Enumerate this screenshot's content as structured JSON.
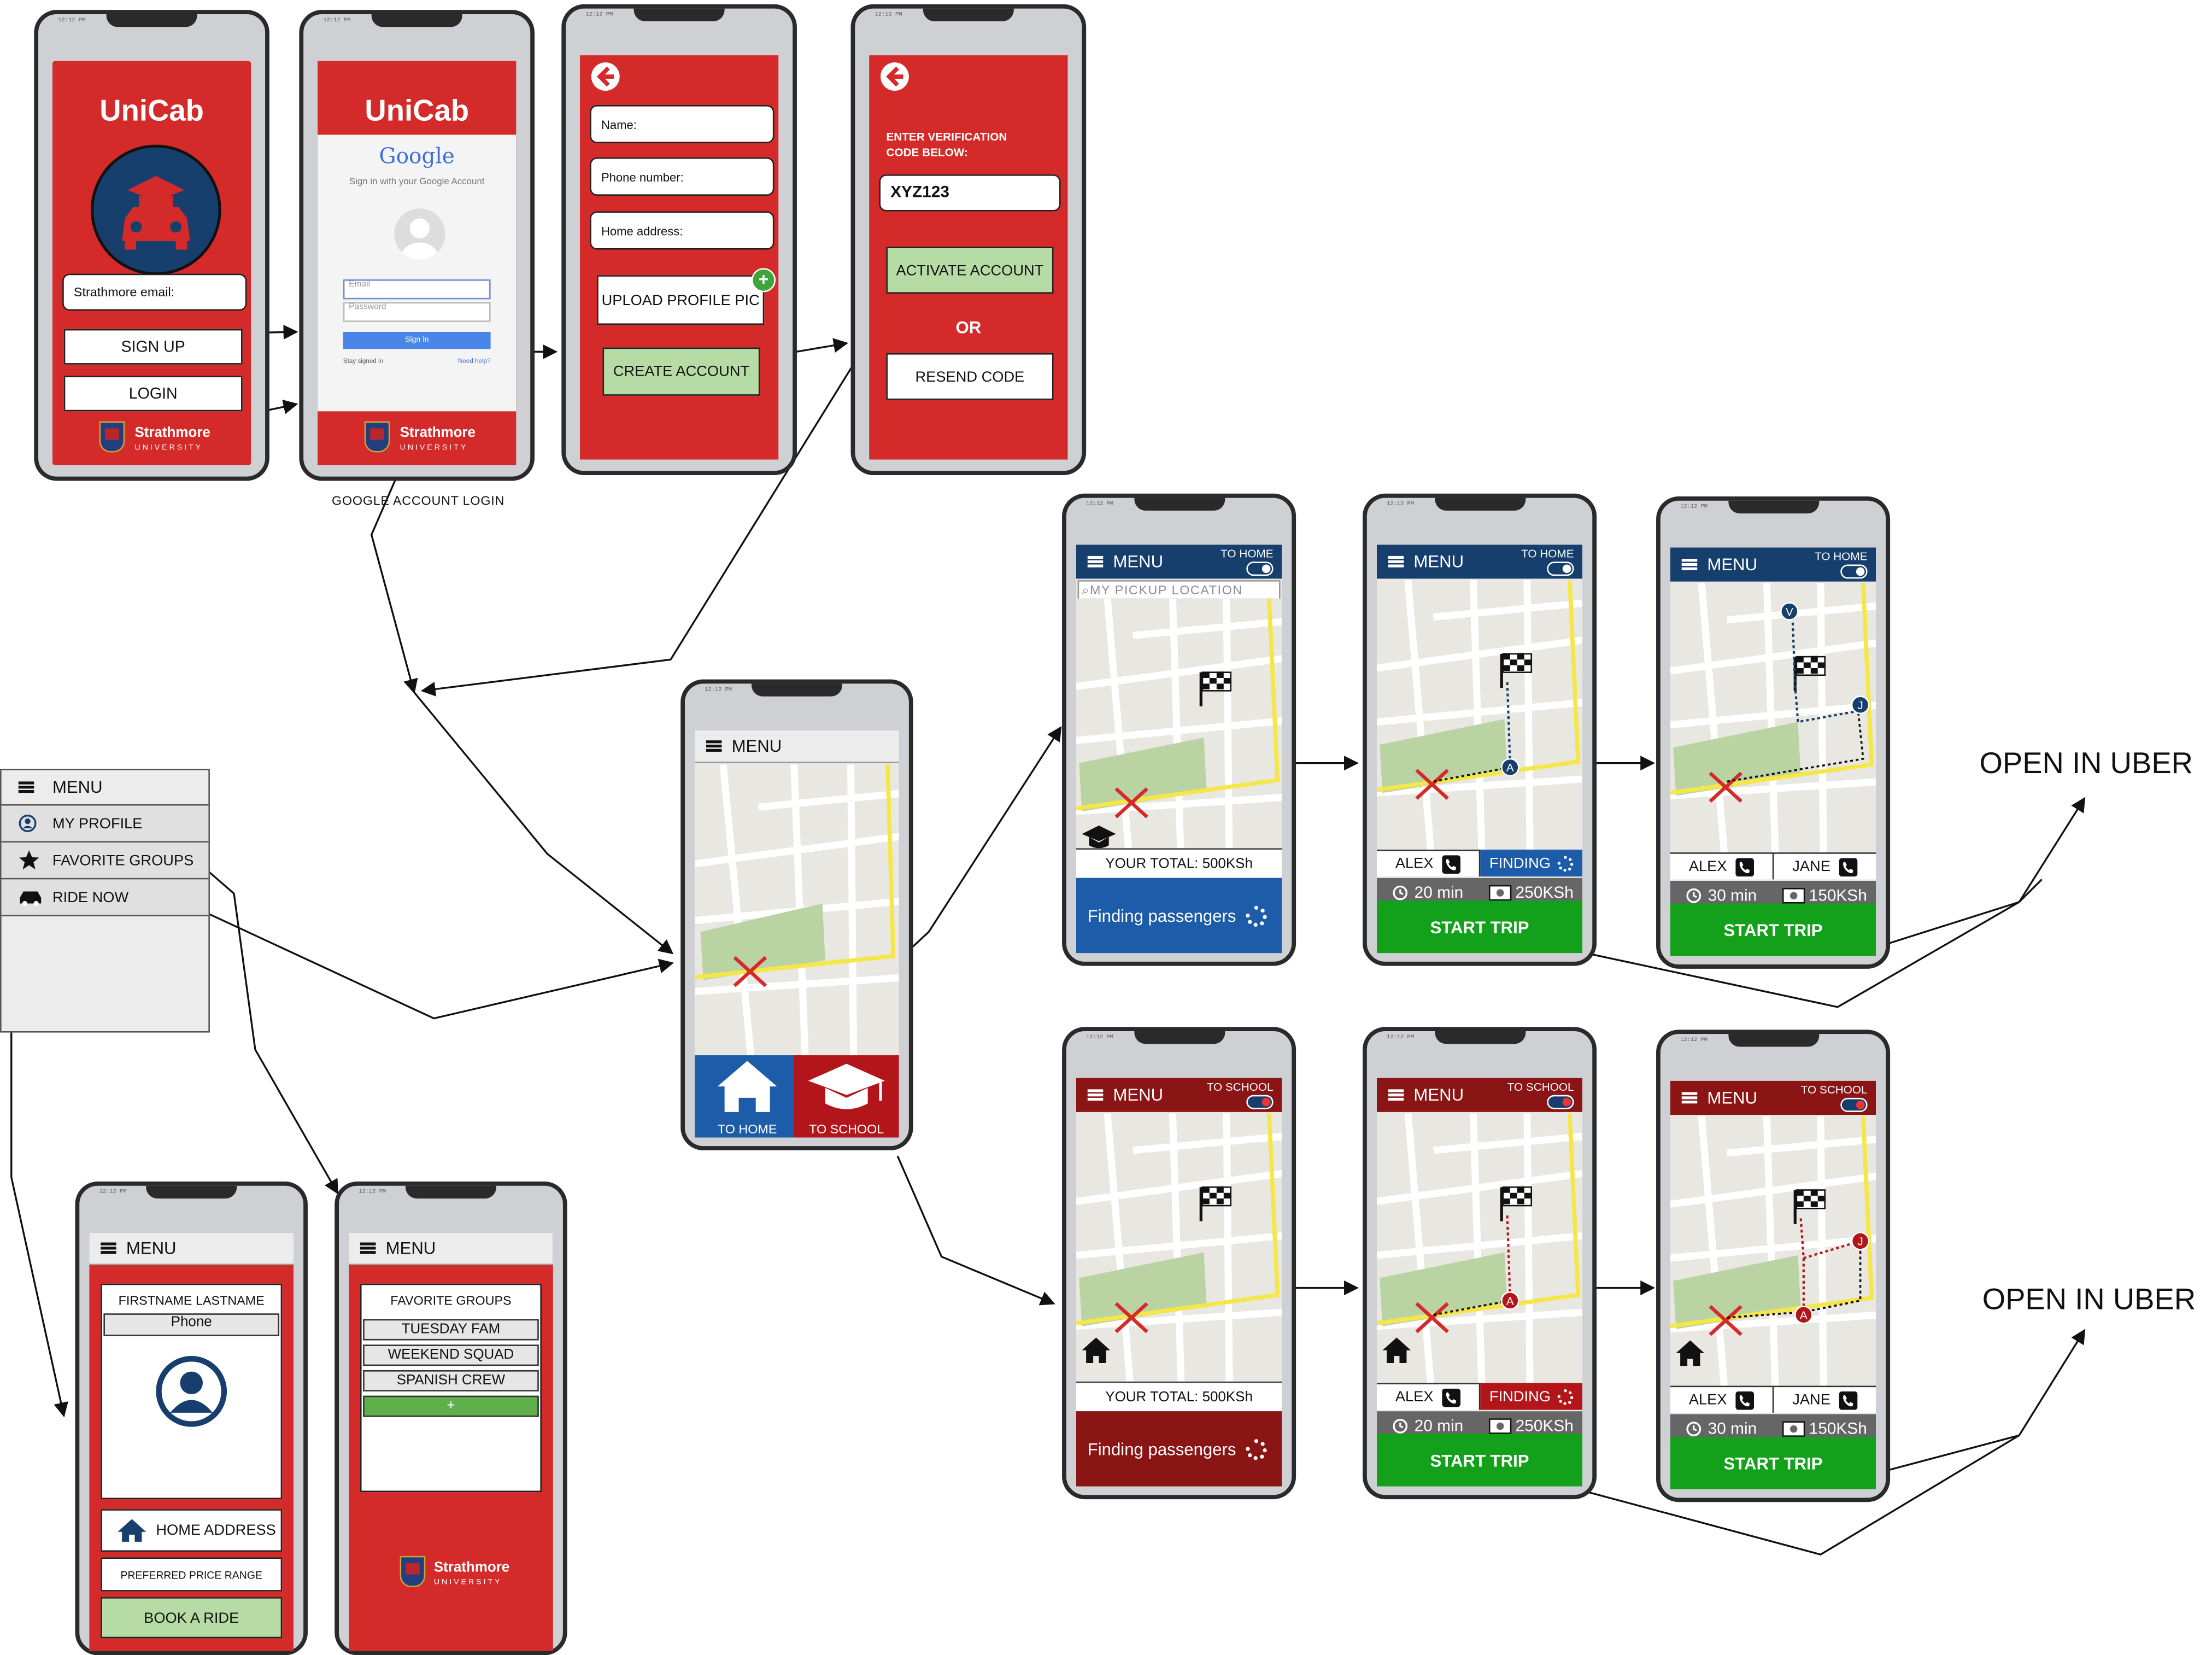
{
  "app": {
    "name": "UniCab"
  },
  "login_screen": {
    "email_placeholder": "Strathmore email:",
    "signup_button": "SIGN UP",
    "login_button": "LOGIN",
    "university_name": "Strathmore",
    "university_sub": "UNIVERSITY"
  },
  "google_screen": {
    "google_logo": "Google",
    "signin_prompt": "Sign in with your Google Account",
    "email_placeholder": "Email",
    "password_placeholder": "Password",
    "signin_button": "Sign in",
    "stay_signed_in": "Stay signed in",
    "need_help": "Need help?",
    "caption": "GOOGLE ACCOUNT LOGIN"
  },
  "register_screen": {
    "name_field": "Name:",
    "phone_field": "Phone number:",
    "address_field": "Home address:",
    "upload_button": "UPLOAD PROFILE PIC",
    "create_button": "CREATE ACCOUNT"
  },
  "verify_screen": {
    "instruction": "ENTER VERIFICATION CODE BELOW:",
    "code_value": "XYZ123",
    "activate_button": "ACTIVATE ACCOUNT",
    "or_text": "OR",
    "resend_button": "RESEND CODE"
  },
  "side_menu": {
    "title": "MENU",
    "items": [
      "MY PROFILE",
      "FAVORITE GROUPS",
      "RIDE NOW"
    ]
  },
  "home_screen": {
    "menu_label": "MENU",
    "to_home": "TO HOME",
    "to_school": "TO SCHOOL"
  },
  "profile_screen": {
    "menu_label": "MENU",
    "name": "FIRSTNAME LASTNAME",
    "phone": "Phone",
    "home_address": "HOME ADDRESS",
    "price_range": "PREFERRED PRICE RANGE",
    "book_button": "BOOK A RIDE"
  },
  "groups_screen": {
    "menu_label": "MENU",
    "heading": "FAVORITE GROUPS",
    "groups": [
      "TUESDAY FAM",
      "WEEKEND SQUAD",
      "SPANISH CREW"
    ],
    "add_label": "+"
  },
  "trip_home": {
    "menu_label": "MENU",
    "direction": "TO HOME",
    "pickup_placeholder": "MY PICKUP LOCATION",
    "total": "YOUR TOTAL: 500KSh",
    "finding_passengers": "Finding passengers",
    "screen2": {
      "passenger1": "ALEX",
      "passenger2": "FINDING",
      "time": "20 min",
      "price": "250KSh",
      "start": "START TRIP"
    },
    "screen3": {
      "passenger1": "ALEX",
      "passenger2": "JANE",
      "time": "30 min",
      "price": "150KSh",
      "start": "START TRIP"
    }
  },
  "trip_school": {
    "menu_label": "MENU",
    "direction": "TO SCHOOL",
    "total": "YOUR TOTAL: 500KSh",
    "finding_passengers": "Finding passengers",
    "screen2": {
      "passenger1": "ALEX",
      "passenger2": "FINDING",
      "time": "20 min",
      "price": "250KSh",
      "start": "START TRIP"
    },
    "screen3": {
      "passenger1": "ALEX",
      "passenger2": "JANE",
      "time": "30 min",
      "price": "150KSh",
      "start": "START TRIP"
    }
  },
  "markers": {
    "a": "A",
    "j": "J",
    "v": "V"
  },
  "open_in_uber": "OPEN IN UBER",
  "colors": {
    "red": "#d52a2a",
    "navy": "#173f6d",
    "maroon": "#8b1414",
    "green": "#13a11b",
    "light_green": "#b7dba4",
    "park": "#b9d3a2",
    "route": "#f5e64a"
  },
  "icons": [
    "graduation-cap-car-icon",
    "google-avatar-icon",
    "back-arrow-icon",
    "plus-icon",
    "home-icon",
    "graduation-cap-icon",
    "checkered-flag-icon",
    "red-x-icon",
    "phone-icon",
    "clock-icon",
    "money-icon",
    "spinner-icon",
    "user-icon",
    "star-icon",
    "car-icon",
    "hamburger-icon"
  ]
}
